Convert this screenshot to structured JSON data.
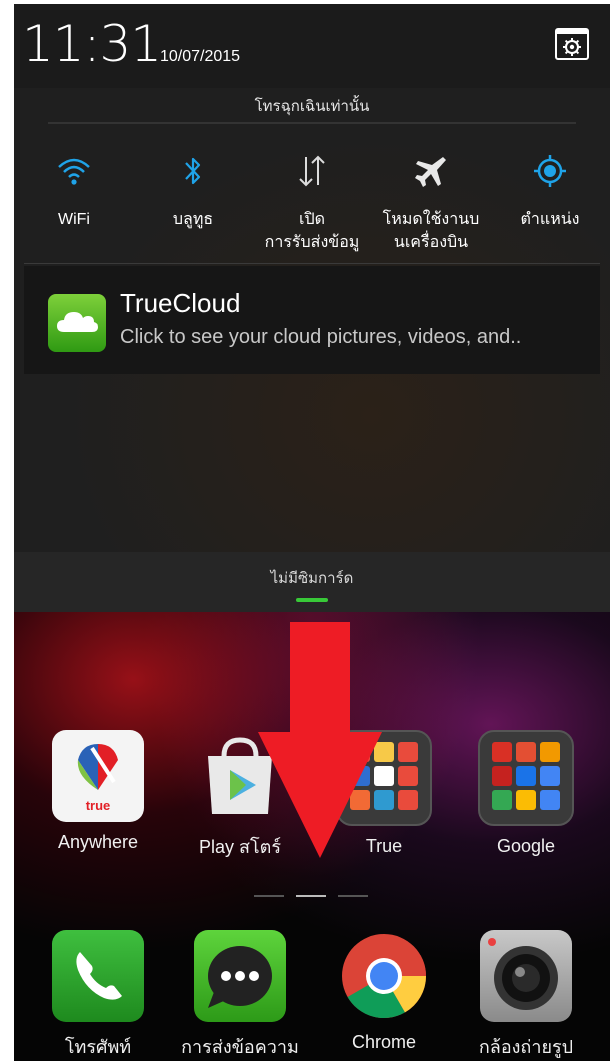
{
  "status_bar": {
    "time": "11:31",
    "date": "10/07/2015"
  },
  "panel": {
    "emergency_text": "โทรฉุกเฉินเท่านั้น",
    "quick_settings": [
      {
        "icon": "wifi-icon",
        "label": "WiFi"
      },
      {
        "icon": "bluetooth-icon",
        "label": "บลูทูธ"
      },
      {
        "icon": "data-transfer-icon",
        "label": "เปิด\nการรับส่งข้อมู"
      },
      {
        "icon": "airplane-icon",
        "label": "โหมดใช้งานบ\nนเครื่องบิน"
      },
      {
        "icon": "location-icon",
        "label": "ตำแหน่ง"
      }
    ],
    "notification": {
      "title": "TrueCloud",
      "text": "Click to see your cloud pictures, videos, and.."
    },
    "no_sim_text": "ไม่มีซิมการ์ด"
  },
  "home": {
    "apps": [
      {
        "label": "Anywhere",
        "icon": "truevisions-icon"
      },
      {
        "label": "Play สโตร์",
        "icon": "play-store-icon"
      },
      {
        "label": "True",
        "icon": "true-folder-icon"
      },
      {
        "label": "Google",
        "icon": "google-folder-icon"
      }
    ],
    "dock": [
      {
        "label": "โทรศัพท์",
        "icon": "phone-icon"
      },
      {
        "label": "การส่งข้อความ",
        "icon": "messaging-icon"
      },
      {
        "label": "Chrome",
        "icon": "chrome-icon"
      },
      {
        "label": "กล้องถ่ายรูป",
        "icon": "camera-icon"
      }
    ]
  },
  "colors": {
    "accent": "#1fa3e8",
    "handle": "#38c938",
    "arrow": "#ee1c25"
  }
}
